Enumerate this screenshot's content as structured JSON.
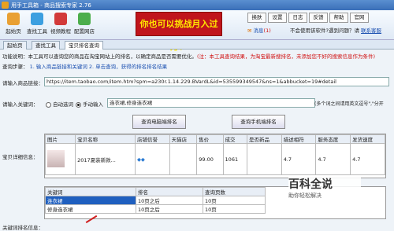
{
  "window": {
    "title": "用手工具箱 - 商品搜索专家 2.76"
  },
  "toolbar": {
    "buttons": [
      "起始页",
      "查找工具",
      "视频教程",
      "配置网店"
    ],
    "banner": "你也可以挑战月入过万！",
    "small_buttons": [
      "换肤",
      "设置",
      "日志",
      "反馈",
      "帮助",
      "官网"
    ],
    "msg_label": "消息",
    "msg_count": "(1)",
    "hint": "不会使用该软件?遇到问题？请",
    "contact": "联系客服"
  },
  "tabs": [
    "起始页",
    "查找工具",
    "宝贝排名查询"
  ],
  "func": {
    "desc_prefix": "功能说明：本工具可以查询您的商品在淘宝网站上的排名，以确定商品是否需要优化。",
    "desc_note": "(注：本工具查询结果，为淘宝最新搜排名，未添加您不好的搜索信息作为条件)",
    "guide_label": "查询步骤：",
    "guide": "1. 输入商品链接和关键词 2. 单击查询，获得的排名排名结果"
  },
  "link": {
    "label": "请输入商品链接：",
    "value": "https://item.taobao.com/item.htm?spm=a230r.1.14.229.BVardL&id=535599349547&ns=1&abbucket=19#detail"
  },
  "keyword": {
    "label": "请输入关键词：",
    "auto": "自动选词",
    "manual": "手动输入",
    "value": "连衣裙,修身连衣裙",
    "hint": "(多个词之间请用英文逗号\",\"分开"
  },
  "buttons": {
    "pc": "查询电脑端排名",
    "mobile": "查询手机端排名"
  },
  "product": {
    "label": "宝贝详细信息：",
    "headers": [
      "图片",
      "宝贝名称",
      "店铺信誉",
      "天猫店",
      "售价",
      "成交",
      "是否新品",
      "描述相符",
      "服务态度",
      "发货速度"
    ],
    "row": {
      "name": "2017夏装新款...",
      "tmall": "",
      "price": "99.00",
      "deals": "1061",
      "new": "",
      "desc": "4.7",
      "service": "4.7",
      "ship": "4.7"
    }
  },
  "rank": {
    "label": "关键词排名信息：",
    "headers": [
      "关键词",
      "排名",
      "查询页数"
    ],
    "rows": [
      {
        "kw": "连衣裙",
        "rank": "10页之后",
        "pages": "10页"
      },
      {
        "kw": "修身连衣裙",
        "rank": "10页之后",
        "pages": "10页"
      }
    ]
  },
  "watermark": {
    "title": "百科全说",
    "sub": "助你轻松解决"
  }
}
